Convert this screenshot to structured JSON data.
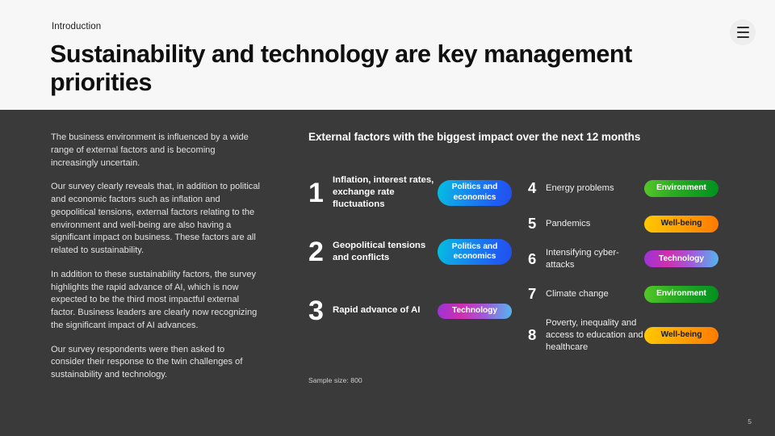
{
  "header": {
    "eyebrow": "Introduction",
    "title": "Sustainability and technology are key management priorities",
    "menu_icon": "hamburger-menu-icon"
  },
  "left_column": {
    "paragraphs": [
      "The business environment is influenced by a wide range of external factors and is becoming increasingly uncertain.",
      "Our survey clearly reveals that, in addition to political and economic factors such as inflation and geopolitical tensions, external factors relating to the environment and well-being are also having a significant impact on business. These factors are all related to sustainability.",
      "In addition to these sustainability factors, the survey highlights the rapid advance of AI, which is now expected to be the third most impactful external factor. Business leaders are clearly now recognizing the significant impact of AI advances.",
      "Our survey respondents were then asked to consider their response to the twin challenges of sustainability and technology."
    ]
  },
  "main": {
    "section_heading": "External factors with the biggest impact over the next 12 months",
    "sample_size": "Sample size: 800",
    "page_number": "5",
    "column_left": [
      {
        "rank": "1",
        "label": "Inflation, interest rates, exchange rate fluctuations",
        "category": "Politics and\neconomics",
        "category_key": "politics"
      },
      {
        "rank": "2",
        "label": "Geopolitical tensions and conflicts",
        "category": "Politics and\neconomics",
        "category_key": "politics"
      },
      {
        "rank": "3",
        "label": "Rapid advance of AI",
        "category": "Technology",
        "category_key": "technology"
      }
    ],
    "column_right": [
      {
        "rank": "4",
        "label": "Energy problems",
        "category": "Environment",
        "category_key": "environment"
      },
      {
        "rank": "5",
        "label": "Pandemics",
        "category": "Well-being",
        "category_key": "wellbeing"
      },
      {
        "rank": "6",
        "label": "Intensifying cyber-attacks",
        "category": "Technology",
        "category_key": "technology"
      },
      {
        "rank": "7",
        "label": "Climate change",
        "category": "Environment",
        "category_key": "environment"
      },
      {
        "rank": "8",
        "label": "Poverty, inequality and access to education and healthcare",
        "category": "Well-being",
        "category_key": "wellbeing"
      }
    ]
  },
  "colors": {
    "header_background": "#f7f7f7",
    "body_background": "#3a3a3a",
    "title_text": "#101010",
    "body_text": "#e2e2e2",
    "politics_from": "#00c2e0",
    "politics_to": "#2150ee",
    "technology_from": "#9a34d6",
    "technology_mid": "#cf2fae",
    "technology_to": "#52b6ef",
    "environment_from": "#55c62a",
    "environment_to": "#00901f",
    "wellbeing_from": "#ffc800",
    "wellbeing_to": "#ff7a00"
  }
}
